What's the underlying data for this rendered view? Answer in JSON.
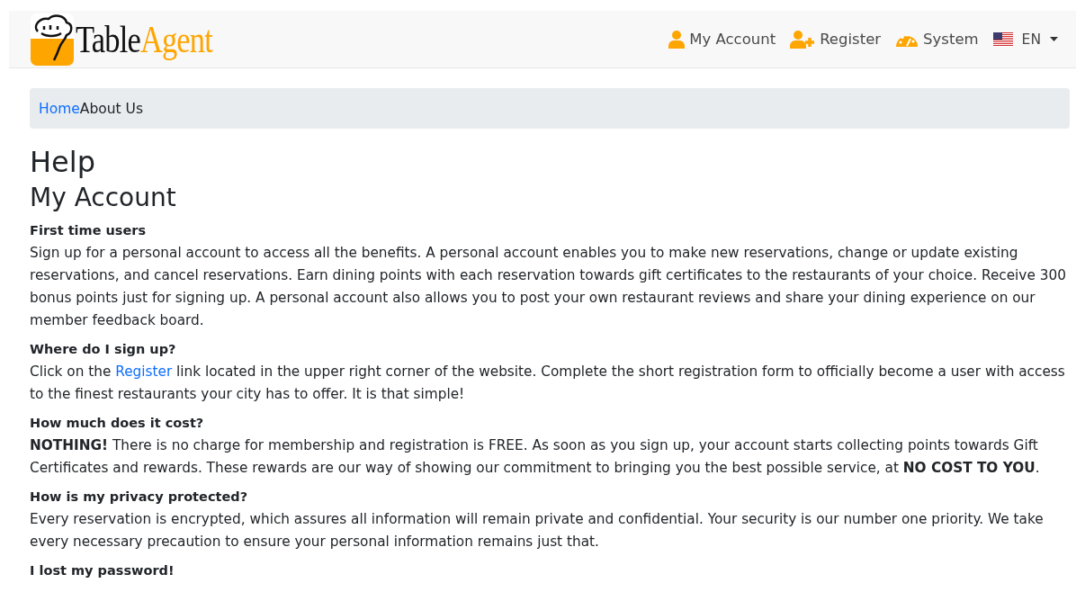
{
  "brand": {
    "first": "Table",
    "second": "Agent"
  },
  "nav": [
    {
      "kind": "user",
      "label": "My Account"
    },
    {
      "kind": "user-plus",
      "label": "Register"
    },
    {
      "kind": "gauge",
      "label": "System"
    }
  ],
  "language": {
    "label": "EN"
  },
  "breadcrumb": [
    {
      "label": "Home",
      "link": true
    },
    {
      "label": "About Us",
      "link": false
    }
  ],
  "title": "Help",
  "section": "My Account",
  "faq": [
    {
      "question": "First time users",
      "answer": [
        {
          "text": "Sign up for a personal account to access all the benefits. A personal account enables you to make new reservations, change or update existing reservations, and cancel reservations. Earn dining points with each reservation towards gift certificates to the restaurants of your choice. Receive 300 bonus points just for signing up. A personal account also allows you to post your own restaurant reviews and share your dining experience on our member feedback board."
        }
      ]
    },
    {
      "question": "Where do I sign up?",
      "answer": [
        {
          "text": "Click on the "
        },
        {
          "link": "Register"
        },
        {
          "text": " link located in the upper right corner of the website. Complete the short registration form to officially become a user with access to the finest restaurants your city has to offer. It is that simple!"
        }
      ]
    },
    {
      "question": "How much does it cost?",
      "answer": [
        {
          "text": "**NOTHING!** There is no charge for membership and registration is FREE. As soon as you sign up, your account starts collecting points towards Gift Certificates and rewards. These rewards are our way of showing our commitment to bringing you the best possible service, at **NO COST TO YOU**."
        }
      ]
    },
    {
      "question": "How is my privacy protected?",
      "answer": [
        {
          "text": "Every reservation is encrypted, which assures all information will remain private and confidential. Your security is our number one priority. We take every necessary precaution to ensure your personal information remains just that."
        }
      ]
    },
    {
      "question": "I lost my password!"
    }
  ]
}
